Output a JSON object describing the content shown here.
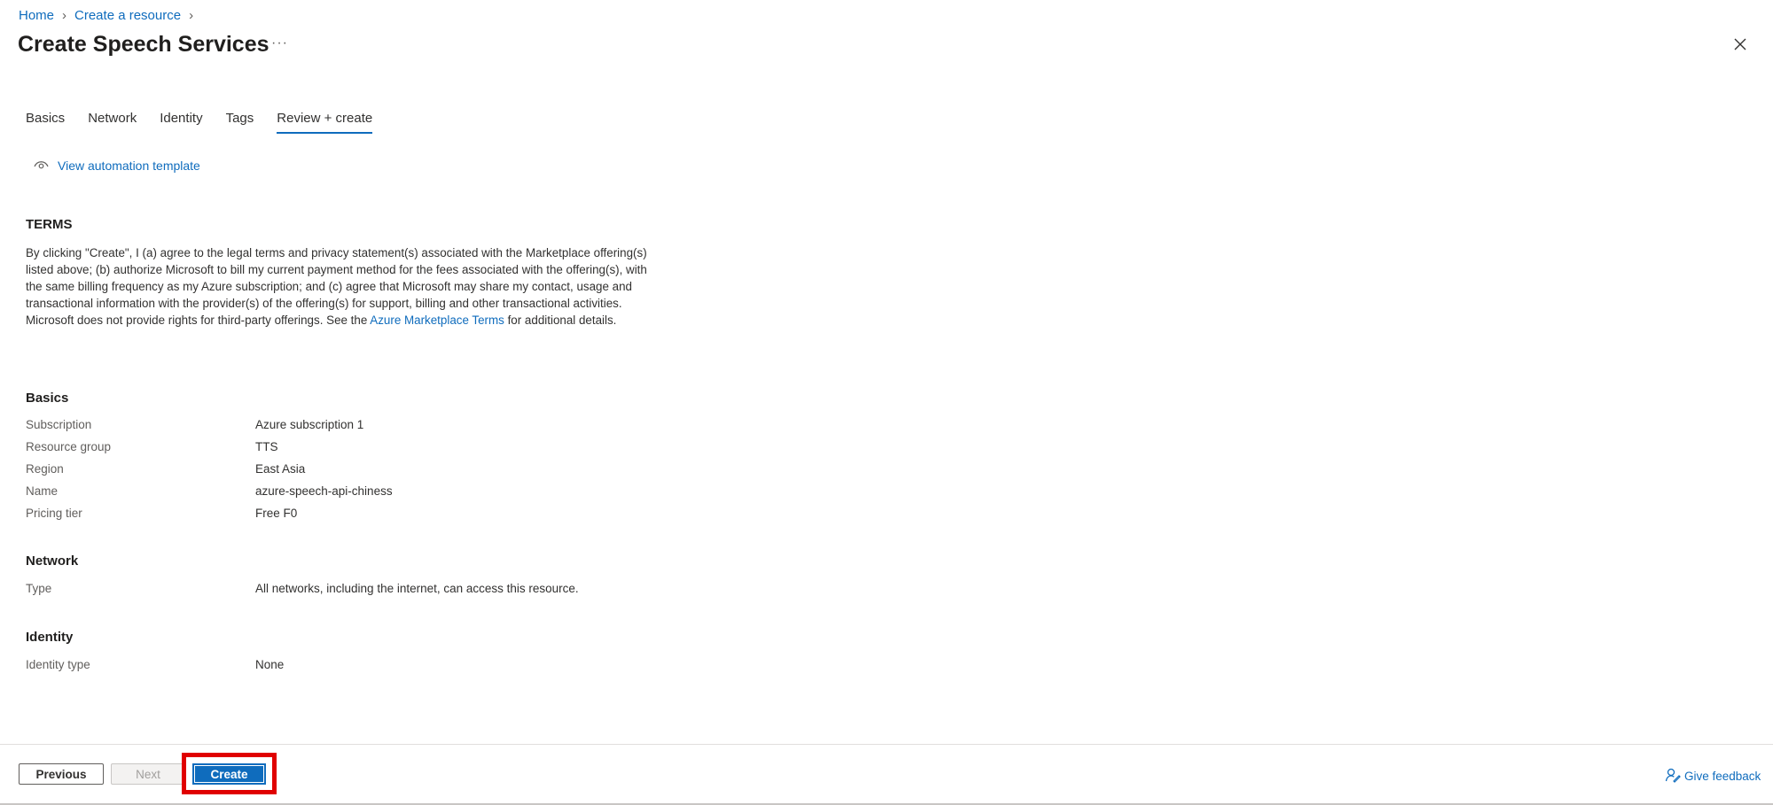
{
  "breadcrumb": {
    "home": "Home",
    "create_resource": "Create a resource"
  },
  "title": "Create Speech Services",
  "more_label": "···",
  "tabs": [
    {
      "label": "Basics"
    },
    {
      "label": "Network"
    },
    {
      "label": "Identity"
    },
    {
      "label": "Tags"
    },
    {
      "label": "Review + create"
    }
  ],
  "active_tab": "Review + create",
  "automation_link": "View automation template",
  "terms": {
    "title": "TERMS",
    "text_before": "By clicking \"Create\", I (a) agree to the legal terms and privacy statement(s) associated with the Marketplace offering(s) listed above; (b) authorize Microsoft to bill my current payment method for the fees associated with the offering(s), with the same billing frequency as my Azure subscription; and (c) agree that Microsoft may share my contact, usage and transactional information with the provider(s) of the offering(s) for support, billing and other transactional activities. Microsoft does not provide rights for third-party offerings. See the ",
    "link": "Azure Marketplace Terms",
    "text_after": " for additional details."
  },
  "basics": {
    "title": "Basics",
    "rows": [
      {
        "label": "Subscription",
        "value": "Azure subscription 1"
      },
      {
        "label": "Resource group",
        "value": "TTS"
      },
      {
        "label": "Region",
        "value": "East Asia"
      },
      {
        "label": "Name",
        "value": "azure-speech-api-chiness"
      },
      {
        "label": "Pricing tier",
        "value": "Free F0"
      }
    ]
  },
  "network": {
    "title": "Network",
    "rows": [
      {
        "label": "Type",
        "value": "All networks, including the internet, can access this resource."
      }
    ]
  },
  "identity": {
    "title": "Identity",
    "rows": [
      {
        "label": "Identity type",
        "value": "None"
      }
    ]
  },
  "footer": {
    "previous": "Previous",
    "next": "Next",
    "create": "Create",
    "feedback": "Give feedback"
  },
  "colors": {
    "accent": "#0f6cbd",
    "highlight": "#e00000"
  }
}
